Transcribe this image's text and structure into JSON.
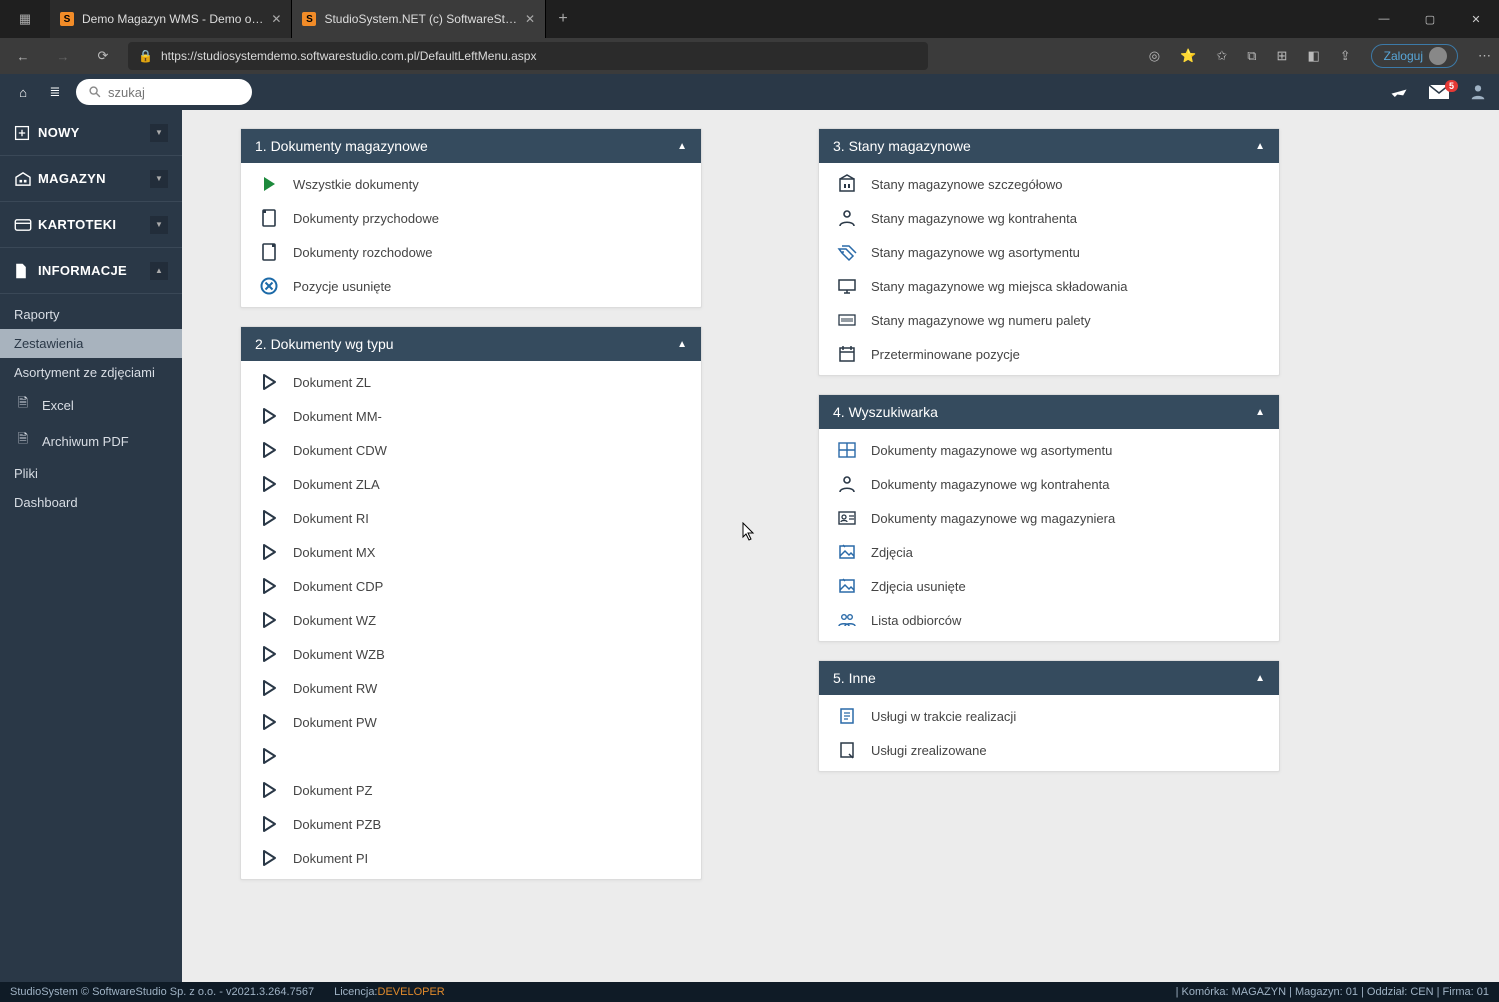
{
  "browser": {
    "tabs": [
      {
        "title": "Demo Magazyn WMS - Demo o…",
        "active": false
      },
      {
        "title": "StudioSystem.NET (c) SoftwareSt…",
        "active": true
      }
    ],
    "url": "https://studiosystemdemo.softwarestudio.com.pl/DefaultLeftMenu.aspx",
    "login_label": "Zaloguj"
  },
  "header": {
    "search_placeholder": "szukaj",
    "mail_badge": "5"
  },
  "sidebar": {
    "groups": [
      {
        "label": "NOWY",
        "icon": "plus-square"
      },
      {
        "label": "MAGAZYN",
        "icon": "warehouse"
      },
      {
        "label": "KARTOTEKI",
        "icon": "card"
      },
      {
        "label": "INFORMACJE",
        "icon": "file",
        "expanded": true
      }
    ],
    "sub": [
      {
        "label": "Raporty"
      },
      {
        "label": "Zestawienia",
        "active": true
      },
      {
        "label": "Asortyment ze zdjęciami"
      },
      {
        "label": "Excel",
        "icon": "xls"
      },
      {
        "label": "Archiwum PDF",
        "icon": "pdf"
      },
      {
        "label": "Pliki"
      },
      {
        "label": "Dashboard"
      }
    ]
  },
  "panels_left": [
    {
      "title": "1. Dokumenty magazynowe",
      "items": [
        {
          "label": "Wszystkie dokumenty",
          "icon": "play-green"
        },
        {
          "label": "Dokumenty przychodowe",
          "icon": "doc-in"
        },
        {
          "label": "Dokumenty rozchodowe",
          "icon": "doc-out"
        },
        {
          "label": "Pozycje usunięte",
          "icon": "remove-circle"
        }
      ]
    },
    {
      "title": "2. Dokumenty wg typu",
      "items": [
        {
          "label": "Dokument ZL",
          "icon": "play"
        },
        {
          "label": "Dokument MM-",
          "icon": "play"
        },
        {
          "label": "Dokument CDW",
          "icon": "play"
        },
        {
          "label": "Dokument ZLA",
          "icon": "play"
        },
        {
          "label": "Dokument RI",
          "icon": "play"
        },
        {
          "label": "Dokument MX",
          "icon": "play"
        },
        {
          "label": "Dokument CDP",
          "icon": "play"
        },
        {
          "label": "Dokument WZ",
          "icon": "play"
        },
        {
          "label": "Dokument WZB",
          "icon": "play"
        },
        {
          "label": "Dokument RW",
          "icon": "play"
        },
        {
          "label": "Dokument PW",
          "icon": "play"
        },
        {
          "label": "",
          "icon": "play"
        },
        {
          "label": "Dokument PZ",
          "icon": "play"
        },
        {
          "label": "Dokument PZB",
          "icon": "play"
        },
        {
          "label": "Dokument PI",
          "icon": "play"
        }
      ]
    }
  ],
  "panels_right": [
    {
      "title": "3. Stany magazynowe",
      "items": [
        {
          "label": "Stany magazynowe szczegółowo",
          "icon": "building"
        },
        {
          "label": "Stany magazynowe wg kontrahenta",
          "icon": "person"
        },
        {
          "label": "Stany magazynowe wg asortymentu",
          "icon": "tags"
        },
        {
          "label": "Stany magazynowe wg miejsca składowania",
          "icon": "monitor"
        },
        {
          "label": "Stany magazynowe wg numeru palety",
          "icon": "barcode"
        },
        {
          "label": "Przeterminowane pozycje",
          "icon": "calendar"
        }
      ]
    },
    {
      "title": "4. Wyszukiwarka",
      "items": [
        {
          "label": "Dokumenty magazynowe wg asortymentu",
          "icon": "shelf"
        },
        {
          "label": "Dokumenty magazynowe wg kontrahenta",
          "icon": "person"
        },
        {
          "label": "Dokumenty magazynowe wg magazyniera",
          "icon": "id-card"
        },
        {
          "label": "Zdjęcia",
          "icon": "photo"
        },
        {
          "label": "Zdjęcia usunięte",
          "icon": "photo"
        },
        {
          "label": "Lista odbiorców",
          "icon": "people"
        }
      ]
    },
    {
      "title": "5. Inne",
      "items": [
        {
          "label": "Usługi w trakcie realizacji",
          "icon": "note"
        },
        {
          "label": "Usługi zrealizowane",
          "icon": "note-done"
        }
      ]
    }
  ],
  "footer": {
    "left1": "StudioSystem © SoftwareStudio Sp. z o.o. - v2021.3.264.7567",
    "license_label": "Licencja: ",
    "license_target": "DEVELOPER",
    "right": "| Komórka: MAGAZYN | Magazyn: 01 | Oddział: CEN | Firma: 01"
  }
}
